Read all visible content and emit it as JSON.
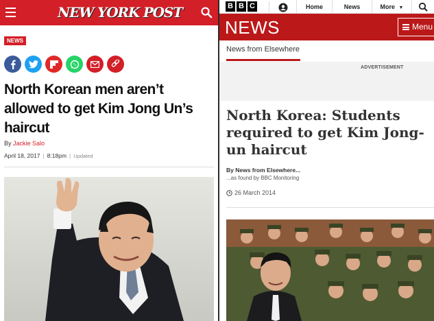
{
  "nypost": {
    "logo": "NEW YORK POST",
    "tag": "NEWS",
    "headline": "North Korean men aren’t allowed to get Kim Jong Un’s haircut",
    "byline_prefix": "By",
    "author": "Jackie Salo",
    "date": "April 18, 2017",
    "time": "8:18pm",
    "updated": "Updated",
    "share": [
      "facebook-icon",
      "twitter-icon",
      "flipboard-icon",
      "whatsapp-icon",
      "email-icon",
      "link-icon"
    ],
    "colors": {
      "brand": "#d31f27"
    }
  },
  "bbc": {
    "logo_letters": [
      "B",
      "B",
      "C"
    ],
    "nav": {
      "home": "Home",
      "news": "News",
      "more": "More"
    },
    "news_label": "NEWS",
    "menu_label": "Menu",
    "section": "News from Elsewhere",
    "advertisement": "ADVERTISEMENT",
    "headline": "North Korea: Students required to get Kim Jong-un haircut",
    "by": "By News from Elsewhere...",
    "found": "...as found by BBC Monitoring",
    "date": "26 March 2014",
    "colors": {
      "brand": "#bb1919"
    }
  }
}
